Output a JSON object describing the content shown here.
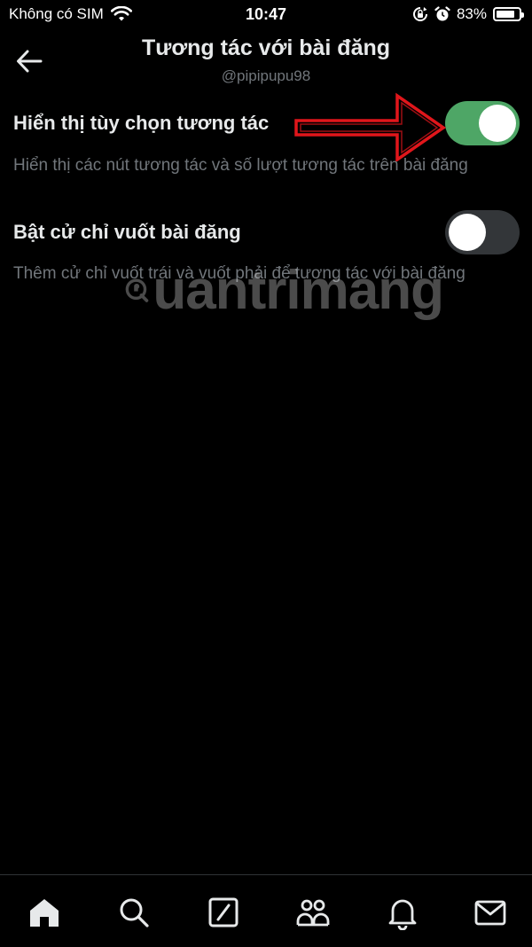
{
  "status_bar": {
    "carrier": "Không có SIM",
    "time": "10:47",
    "battery": "83%",
    "battery_level": 0.83,
    "icons": [
      "wifi-icon",
      "rotation-lock-icon",
      "alarm-icon",
      "battery-icon"
    ]
  },
  "header": {
    "title": "Tương tác với bài đăng",
    "subtitle": "@pipipupu98",
    "back_icon": "arrow-left-icon"
  },
  "settings": [
    {
      "label": "Hiển thị tùy chọn tương tác",
      "description": "Hiển thị các nút tương tác và số lượt tương tác trên bài đăng",
      "enabled": true
    },
    {
      "label": "Bật cử chỉ vuốt bài đăng",
      "description": "Thêm cử chỉ vuốt trái và vuốt phải để tương tác với bài đăng",
      "enabled": false
    }
  ],
  "annotation": {
    "type": "red-arrow",
    "color": "#e0161b"
  },
  "watermark": {
    "text": "uantrimang"
  },
  "tab_bar": {
    "tabs": [
      "home-icon",
      "search-icon",
      "compose-icon",
      "communities-icon",
      "notifications-icon",
      "messages-icon"
    ]
  },
  "colors": {
    "background": "#000000",
    "toggle_on": "#4ea666",
    "toggle_off": "#333639",
    "text_primary": "#e7e9ea",
    "text_secondary": "#71767b"
  }
}
